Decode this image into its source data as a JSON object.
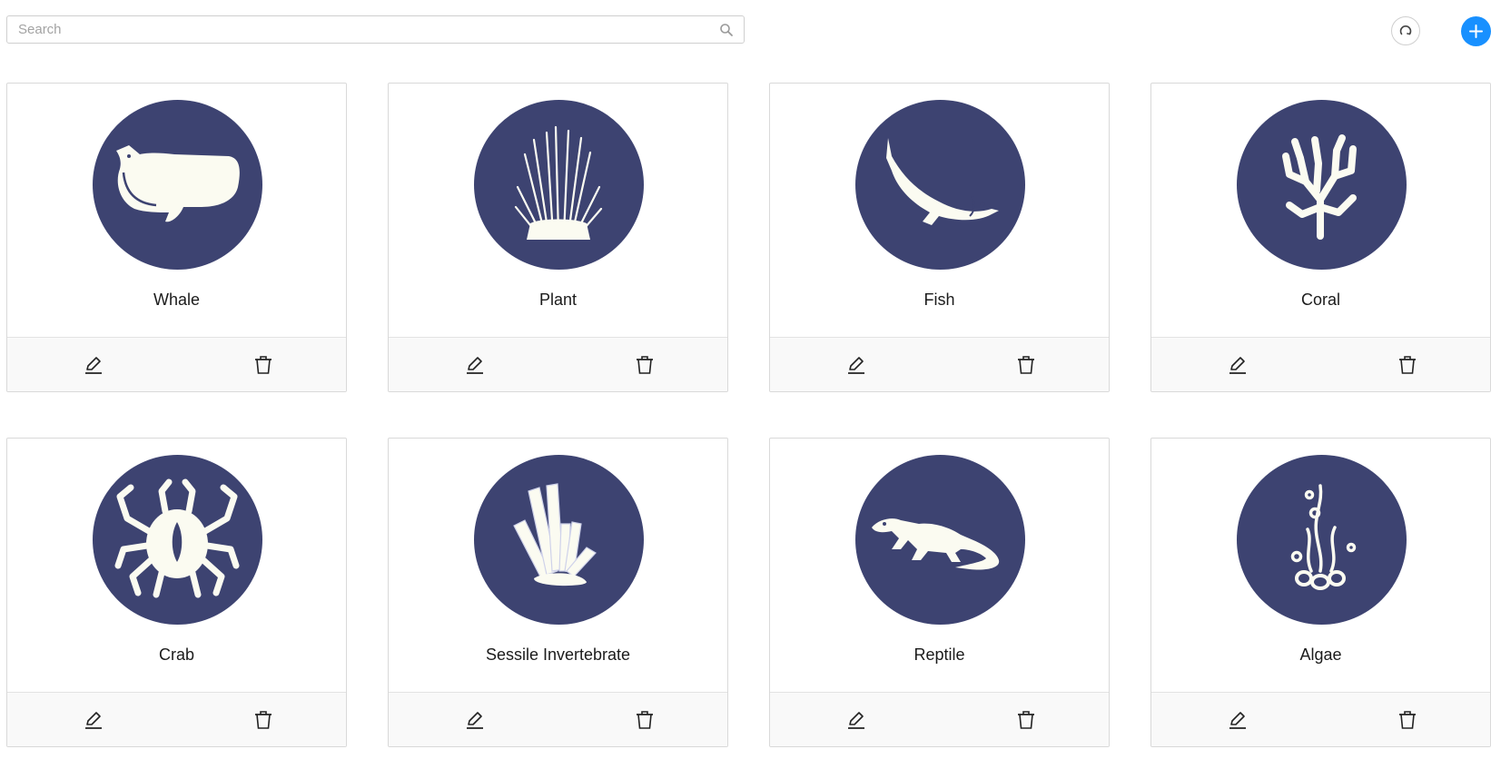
{
  "search": {
    "placeholder": "Search",
    "value": ""
  },
  "toolbar": {
    "refresh_icon": "refresh-icon",
    "add_icon": "plus-icon"
  },
  "colors": {
    "accent": "#1890ff",
    "avatar_bg": "#3d4371",
    "footer_bg": "#f9f9f9",
    "border": "#d9d9d9"
  },
  "cards": [
    {
      "label": "Whale",
      "icon": "whale-icon"
    },
    {
      "label": "Plant",
      "icon": "plant-icon"
    },
    {
      "label": "Fish",
      "icon": "fish-icon"
    },
    {
      "label": "Coral",
      "icon": "coral-icon"
    },
    {
      "label": "Crab",
      "icon": "crab-icon"
    },
    {
      "label": "Sessile Invertebrate",
      "icon": "sessile-invertebrate-icon"
    },
    {
      "label": "Reptile",
      "icon": "reptile-icon"
    },
    {
      "label": "Algae",
      "icon": "algae-icon"
    }
  ],
  "card_actions": {
    "edit_icon": "edit-icon",
    "delete_icon": "delete-icon"
  }
}
